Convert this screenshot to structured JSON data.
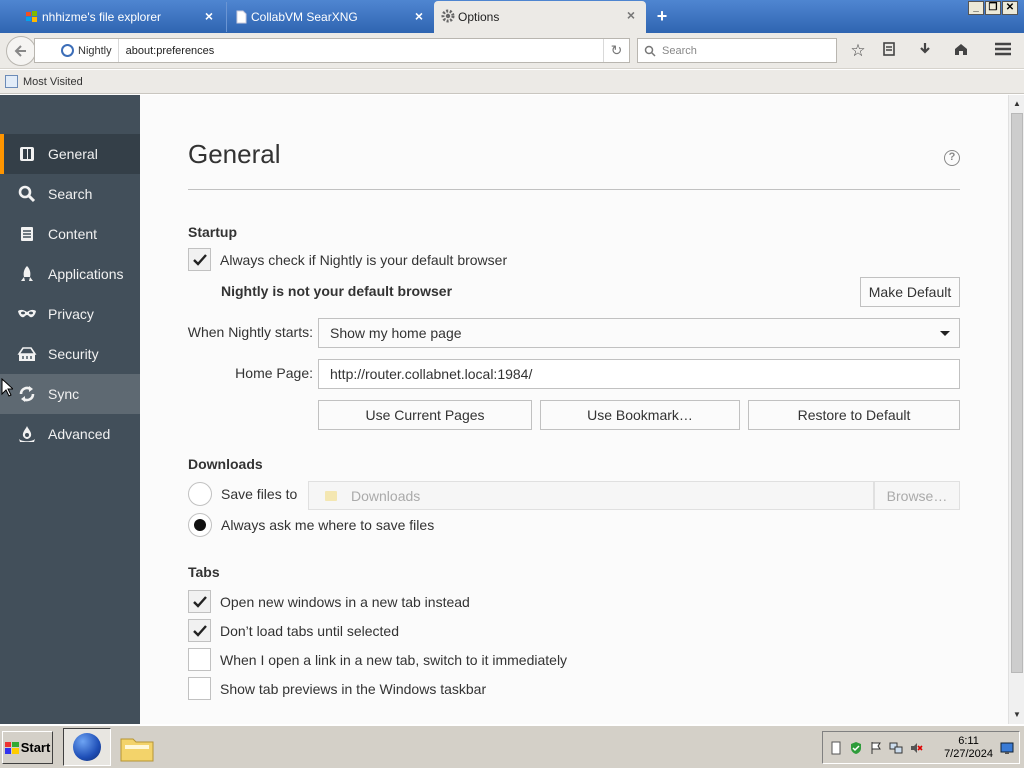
{
  "tabs": [
    {
      "label": "nhhizme's file explorer",
      "close": "×",
      "icon": "windows-logo-icon"
    },
    {
      "label": "CollabVM SearXNG",
      "close": "×",
      "icon": "page-icon"
    },
    {
      "label": "Options",
      "close": "×",
      "icon": "gear-icon"
    }
  ],
  "new_tab": "+",
  "window_buttons": {
    "minimize": "_",
    "restore": "❐",
    "close": "✕"
  },
  "nav": {
    "identity_label": "Nightly",
    "url": "about:preferences",
    "search_placeholder": "Search"
  },
  "bookmarks": {
    "most_visited": "Most Visited"
  },
  "sidebar": {
    "items": [
      {
        "label": "General",
        "icon": "general-icon"
      },
      {
        "label": "Search",
        "icon": "search-icon"
      },
      {
        "label": "Content",
        "icon": "content-icon"
      },
      {
        "label": "Applications",
        "icon": "applications-icon"
      },
      {
        "label": "Privacy",
        "icon": "privacy-mask-icon"
      },
      {
        "label": "Security",
        "icon": "security-icon"
      },
      {
        "label": "Sync",
        "icon": "sync-icon"
      },
      {
        "label": "Advanced",
        "icon": "advanced-icon"
      }
    ],
    "selected": "General",
    "hovered": "Sync"
  },
  "general": {
    "title": "General",
    "help": "?",
    "startup": {
      "heading": "Startup",
      "always_check": {
        "label": "Always check if Nightly is your default browser",
        "checked": true
      },
      "not_default_text": "Nightly is not your default browser",
      "make_default": "Make Default",
      "when_starts_label": "When Nightly starts:",
      "when_starts_value": "Show my home page",
      "home_page_label": "Home Page:",
      "home_page_value": "http://router.collabnet.local:1984/",
      "use_current": "Use Current Pages",
      "use_bookmark": "Use Bookmark…",
      "restore_default": "Restore to Default"
    },
    "downloads": {
      "heading": "Downloads",
      "save_files_to": {
        "label": "Save files to",
        "selected": false
      },
      "folder": "Downloads",
      "browse": "Browse…",
      "always_ask": {
        "label": "Always ask me where to save files",
        "selected": true
      }
    },
    "tabs": {
      "heading": "Tabs",
      "options": [
        {
          "label": "Open new windows in a new tab instead",
          "checked": true
        },
        {
          "label": "Don’t load tabs until selected",
          "checked": true
        },
        {
          "label": "When I open a link in a new tab, switch to it immediately",
          "checked": false
        },
        {
          "label": "Show tab previews in the Windows taskbar",
          "checked": false
        }
      ]
    }
  },
  "taskbar": {
    "start": "Start",
    "time": "6:11",
    "date": "7/27/2024"
  }
}
